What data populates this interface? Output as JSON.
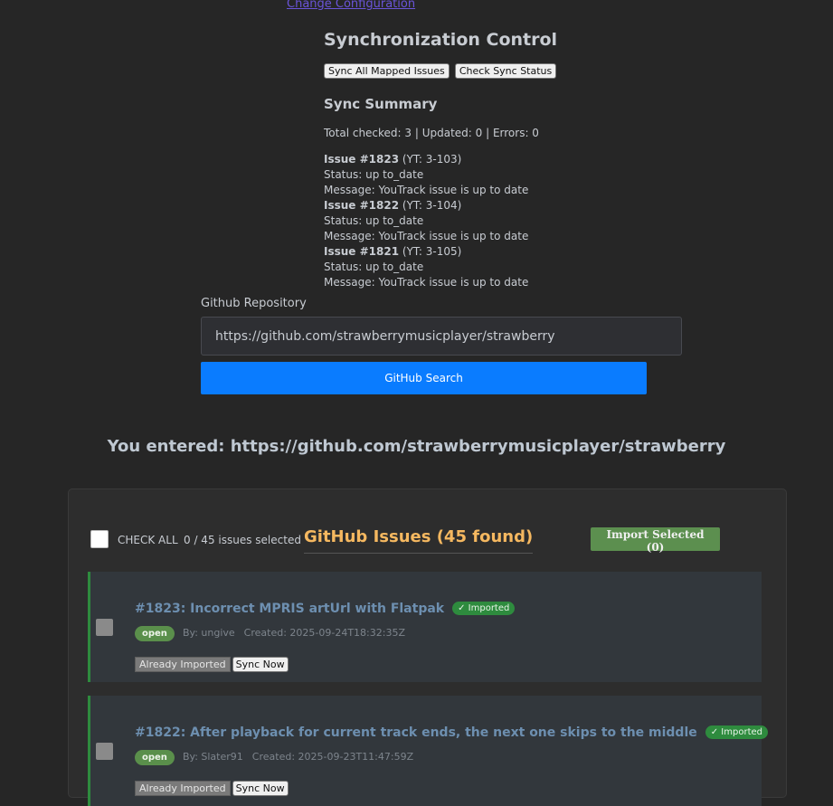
{
  "config": {
    "link_label": "Change Configuration"
  },
  "sync": {
    "title": "Synchronization Control",
    "sync_all_label": "Sync All Mapped Issues",
    "check_status_label": "Check Sync Status",
    "summary_title": "Sync Summary",
    "total_line": "Total checked: 3 | Updated: 0 | Errors: 0",
    "results": [
      {
        "issue": "Issue #1823",
        "yt": "(YT: 3-103)",
        "status": "Status: up to_date",
        "message": "Message: YouTrack issue is up to date"
      },
      {
        "issue": "Issue #1822",
        "yt": "(YT: 3-104)",
        "status": "Status: up to_date",
        "message": "Message: YouTrack issue is up to date"
      },
      {
        "issue": "Issue #1821",
        "yt": "(YT: 3-105)",
        "status": "Status: up to_date",
        "message": "Message: YouTrack issue is up to date"
      }
    ]
  },
  "repo": {
    "label": "Github Repository",
    "value": "https://github.com/strawberrymusicplayer/strawberry",
    "search_label": "GitHub Search",
    "entered_text": "You entered: https://github.com/strawberrymusicplayer/strawberry"
  },
  "issues_panel": {
    "check_all_label": "CHECK ALL",
    "selected_count": "0 / 45 issues selected",
    "title": "GitHub Issues (45 found)",
    "import_label": "Import Selected (0)",
    "issues": [
      {
        "title": "#1823: Incorrect MPRIS artUrl with Flatpak",
        "imported_badge": "✓ Imported",
        "state": "open",
        "author": "By: ungive",
        "created": "Created: 2025-09-24T18:32:35Z",
        "already_label": "Already Imported",
        "sync_label": "Sync Now"
      },
      {
        "title": "#1822: After playback for current track ends, the next one skips to the middle",
        "imported_badge": "✓ Imported",
        "state": "open",
        "author": "By: Slater91",
        "created": "Created: 2025-09-23T11:47:59Z",
        "already_label": "Already Imported",
        "sync_label": "Sync Now"
      }
    ]
  },
  "colors": {
    "background": "#262626",
    "primary_button": "#0a7cff",
    "issues_title": "#f5b860",
    "imported_green": "#2e8b3e",
    "import_button": "#5c8f4f"
  }
}
